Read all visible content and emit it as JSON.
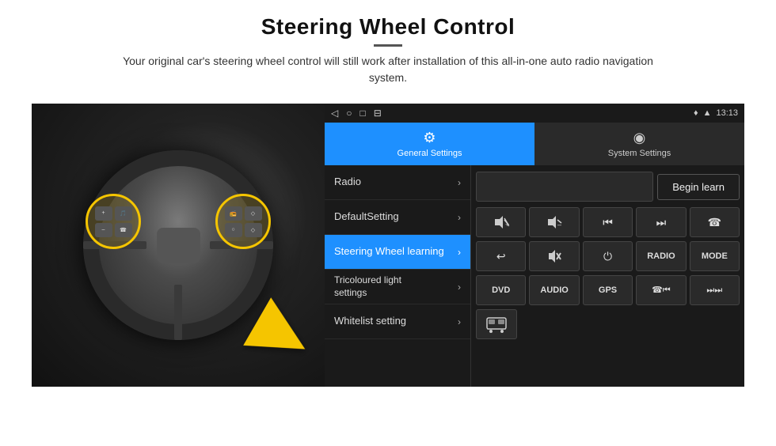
{
  "page": {
    "title": "Steering Wheel Control",
    "subtitle": "Your original car's steering wheel control will still work after installation of this all-in-one auto radio navigation system.",
    "divider_color": "#555"
  },
  "status_bar": {
    "time": "13:13",
    "nav_icons": [
      "◁",
      "○",
      "□",
      "⊟"
    ]
  },
  "tabs": [
    {
      "id": "general",
      "label": "General Settings",
      "icon": "⚙",
      "active": true
    },
    {
      "id": "system",
      "label": "System Settings",
      "icon": "◉",
      "active": false
    }
  ],
  "menu": {
    "items": [
      {
        "id": "radio",
        "label": "Radio",
        "active": false
      },
      {
        "id": "defaultsetting",
        "label": "DefaultSetting",
        "active": false
      },
      {
        "id": "steering",
        "label": "Steering Wheel learning",
        "active": true
      },
      {
        "id": "tricoloured",
        "label": "Tricoloured light settings",
        "active": false
      },
      {
        "id": "whitelist",
        "label": "Whitelist setting",
        "active": false
      }
    ]
  },
  "controls": {
    "begin_learn_label": "Begin learn",
    "buttons_row1": [
      "🔊+",
      "🔊–",
      "⏮",
      "⏭",
      "☎"
    ],
    "buttons_row2": [
      "↩",
      "🔇",
      "⏻",
      "RADIO",
      "MODE"
    ],
    "buttons_row3": [
      "DVD",
      "AUDIO",
      "GPS",
      "☎⏭",
      "⏭⏭"
    ],
    "buttons_row4": [
      "🚌"
    ]
  }
}
